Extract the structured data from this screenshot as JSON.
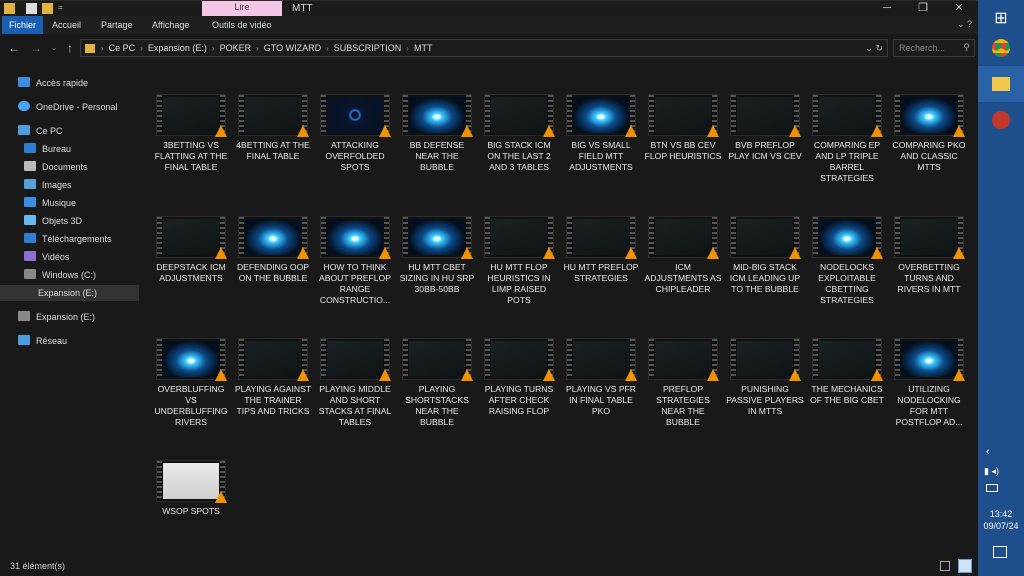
{
  "window": {
    "title": "MTT",
    "context_tab": "Lire",
    "controls": {
      "minimize": "─",
      "maximize": "❐",
      "close": "✕"
    }
  },
  "ribbon": {
    "tabs": [
      "Fichier",
      "Accueil",
      "Partage",
      "Affichage",
      "Outils de vidéo"
    ],
    "active_tab": "Fichier"
  },
  "address": {
    "crumbs": [
      "Ce PC",
      "Expansion (E:)",
      "POKER",
      "GTO WIZARD",
      "SUBSCRIPTION",
      "MTT"
    ],
    "search_placeholder": "Recherch..."
  },
  "nav": {
    "items": [
      {
        "label": "Accès rapide",
        "icon": "star-icon"
      },
      {
        "label": "OneDrive - Personal",
        "icon": "cloud-icon"
      },
      {
        "label": "Ce PC",
        "icon": "computer-icon"
      },
      {
        "label": "Bureau",
        "icon": "folder-icon"
      },
      {
        "label": "Documents",
        "icon": "document-icon"
      },
      {
        "label": "Images",
        "icon": "image-icon"
      },
      {
        "label": "Musique",
        "icon": "music-icon"
      },
      {
        "label": "Objets 3D",
        "icon": "cube-icon"
      },
      {
        "label": "Téléchargements",
        "icon": "download-icon"
      },
      {
        "label": "Vidéos",
        "icon": "video-icon"
      },
      {
        "label": "Windows (C:)",
        "icon": "drive-icon"
      },
      {
        "label": "Expansion (E:)",
        "icon": "drive-icon"
      },
      {
        "label": "Expansion (E:)",
        "icon": "drive-icon"
      },
      {
        "label": "Réseau",
        "icon": "network-icon"
      }
    ]
  },
  "files": [
    {
      "name": "3BETTING VS FLATTING AT THE FINAL TABLE",
      "thumb": "slide"
    },
    {
      "name": "4BETTING AT THE FINAL TABLE",
      "thumb": "slide"
    },
    {
      "name": "ATTACKING OVERFOLDED SPOTS",
      "thumb": "ring"
    },
    {
      "name": "BB DEFENSE NEAR THE BUBBLE",
      "thumb": "burst"
    },
    {
      "name": "BIG STACK ICM ON THE LAST 2 AND 3 TABLES",
      "thumb": "slide"
    },
    {
      "name": "BIG VS SMALL FIELD MTT ADJUSTMENTS",
      "thumb": "burst"
    },
    {
      "name": "BTN VS BB CEV FLOP HEURISTICS",
      "thumb": "slide"
    },
    {
      "name": "BVB PREFLOP PLAY ICM VS CEV",
      "thumb": "slide"
    },
    {
      "name": "COMPARING EP AND LP TRIPLE BARREL STRATEGIES",
      "thumb": "slide"
    },
    {
      "name": "COMPARING PKO AND CLASSIC MTTS",
      "thumb": "burst"
    },
    {
      "name": "DEEPSTACK ICM ADJUSTMENTS",
      "thumb": "slide"
    },
    {
      "name": "DEFENDING OOP ON THE BUBBLE",
      "thumb": "burst"
    },
    {
      "name": "HOW TO THINK ABOUT PREFLOP RANGE CONSTRUCTIO...",
      "thumb": "burst"
    },
    {
      "name": "HU MTT CBET SIZING IN HU SRP 30BB-50BB",
      "thumb": "burst"
    },
    {
      "name": "HU MTT FLOP HEURISTICS IN LIMP RAISED POTS",
      "thumb": "slide"
    },
    {
      "name": "HU MTT PREFLOP STRATEGIES",
      "thumb": "slide"
    },
    {
      "name": "ICM ADJUSTMENTS AS CHIPLEADER",
      "thumb": "slide"
    },
    {
      "name": "MID-BIG STACK ICM LEADING UP TO THE BUBBLE",
      "thumb": "slide"
    },
    {
      "name": "NODELOCKS EXPLOITABLE CBETTING STRATEGIES",
      "thumb": "burst"
    },
    {
      "name": "OVERBETTING TURNS AND RIVERS IN MTT",
      "thumb": "slide"
    },
    {
      "name": "OVERBLUFFING VS UNDERBLUFFING RIVERS",
      "thumb": "burst"
    },
    {
      "name": "PLAYING AGAINST THE TRAINER TIPS AND TRICKS",
      "thumb": "slide"
    },
    {
      "name": "PLAYING MIDDLE AND SHORT STACKS AT FINAL TABLES",
      "thumb": "slide"
    },
    {
      "name": "PLAYING SHORTSTACKS NEAR THE BUBBLE",
      "thumb": "slide"
    },
    {
      "name": "PLAYING TURNS AFTER CHECK RAISING FLOP",
      "thumb": "slide"
    },
    {
      "name": "PLAYING VS PFR IN FINAL TABLE PKO",
      "thumb": "slide"
    },
    {
      "name": "PREFLOP STRATEGIES NEAR THE BUBBLE",
      "thumb": "slide"
    },
    {
      "name": "PUNISHING PASSIVE PLAYERS IN MTTS",
      "thumb": "slide"
    },
    {
      "name": "THE MECHANICS OF THE BIG CBET",
      "thumb": "slide"
    },
    {
      "name": "UTILIZING NODELOCKING FOR MTT POSTFLOP AD...",
      "thumb": "burst"
    },
    {
      "name": "WSOP SPOTS",
      "thumb": "person"
    }
  ],
  "status": {
    "count": "31 élément(s)"
  },
  "taskbar": {
    "time": "13:42",
    "date": "09/07/24"
  }
}
